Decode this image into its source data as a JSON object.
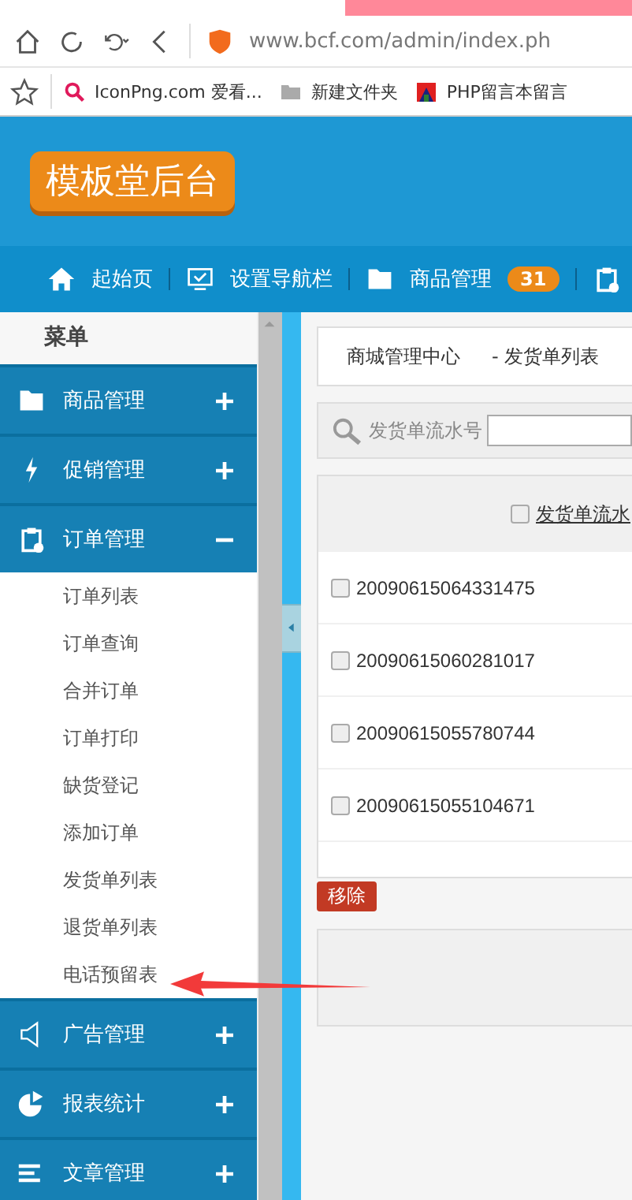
{
  "browser": {
    "address": "www.bcf.com/admin/index.ph",
    "bookmarks": [
      {
        "kind": "search",
        "label": "IconPng.com 爱看..."
      },
      {
        "kind": "folder",
        "label": "新建文件夹"
      },
      {
        "kind": "site",
        "label": "PHP留言本留言"
      }
    ]
  },
  "header": {
    "logo": "模板堂后台"
  },
  "top_nav": [
    {
      "kind": "home",
      "label": "起始页"
    },
    {
      "kind": "monitor",
      "label": "设置导航栏"
    },
    {
      "kind": "folder",
      "label": "商品管理",
      "badge": "31"
    },
    {
      "kind": "clipboard"
    }
  ],
  "sidebar": {
    "title": "菜单",
    "groups": [
      {
        "kind": "folder",
        "label": "商品管理",
        "expanded": false
      },
      {
        "kind": "bolt",
        "label": "促销管理",
        "expanded": false
      },
      {
        "kind": "clipboard",
        "label": "订单管理",
        "expanded": true,
        "children": [
          "订单列表",
          "订单查询",
          "合并订单",
          "订单打印",
          "缺货登记",
          "添加订单",
          "发货单列表",
          "退货单列表",
          "电话预留表"
        ]
      },
      {
        "kind": "speaker",
        "label": "广告管理",
        "expanded": false
      },
      {
        "kind": "chart",
        "label": "报表统计",
        "expanded": false
      },
      {
        "kind": "lines",
        "label": "文章管理",
        "expanded": false
      }
    ]
  },
  "breadcrumb": [
    "商城管理中心",
    "- 发货单列表"
  ],
  "search": {
    "label": "发货单流水号"
  },
  "table": {
    "column_1": {
      "label": "发货单流水",
      "checked": false
    },
    "rows": [
      {
        "id": "20090615064331475",
        "checked": false
      },
      {
        "id": "20090615060281017",
        "checked": false
      },
      {
        "id": "20090615055780744",
        "checked": false
      },
      {
        "id": "20090615055104671",
        "checked": false
      }
    ]
  },
  "remove_button": "移除"
}
